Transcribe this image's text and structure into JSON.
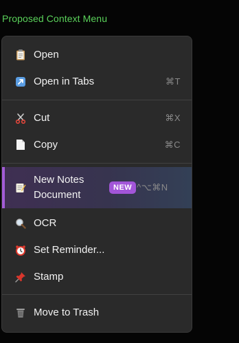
{
  "heading": "Proposed Context Menu",
  "colors": {
    "heading": "#5ad15a",
    "menu_bg": "#2a2a2a",
    "accent": "#a25bd6",
    "badge_bg": "#a255d8",
    "shortcut": "#8a8a8a"
  },
  "menu": {
    "items": {
      "open": {
        "label": "Open",
        "icon": "clipboard-icon",
        "shortcut": ""
      },
      "open_tabs": {
        "label": "Open in Tabs",
        "icon": "arrow-up-right-box-icon",
        "shortcut": "⌘T"
      },
      "cut": {
        "label": "Cut",
        "icon": "scissors-icon",
        "shortcut": "⌘X"
      },
      "copy": {
        "label": "Copy",
        "icon": "document-icon",
        "shortcut": "⌘C"
      },
      "new_notes": {
        "label": "New Notes Document",
        "icon": "memo-icon",
        "badge": "NEW",
        "shortcut": "^⌥⌘N"
      },
      "ocr": {
        "label": "OCR",
        "icon": "magnifier-icon",
        "shortcut": ""
      },
      "reminder": {
        "label": "Set Reminder...",
        "icon": "alarm-clock-icon",
        "shortcut": ""
      },
      "stamp": {
        "label": "Stamp",
        "icon": "pushpin-icon",
        "shortcut": ""
      },
      "trash": {
        "label": "Move to Trash",
        "icon": "trash-icon",
        "shortcut": ""
      }
    }
  }
}
